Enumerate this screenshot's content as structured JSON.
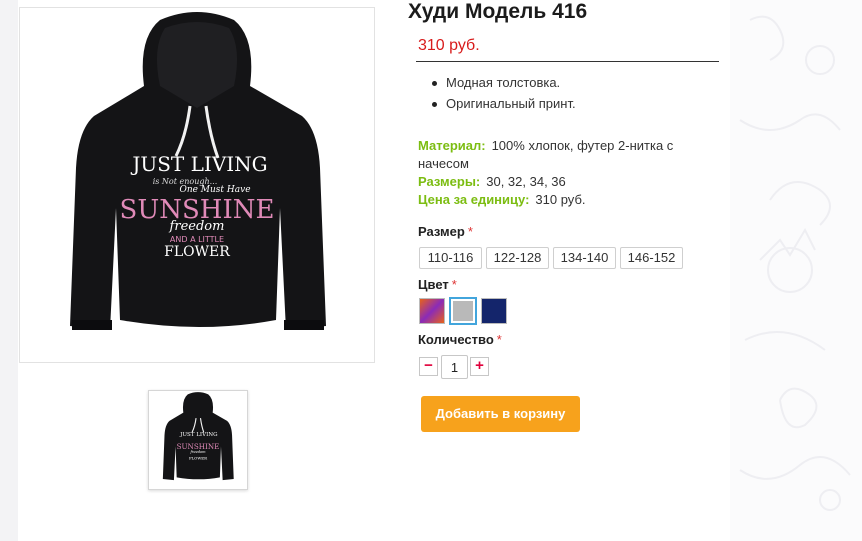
{
  "product": {
    "title": "Худи Модель 416",
    "price": "310 руб.",
    "features": [
      "Модная толстовка.",
      "Оригинальный принт."
    ],
    "specs": {
      "material_label": "Материал:",
      "material_value": "100% хлопок, футер 2-нитка с начесом",
      "sizes_label": "Размеры:",
      "sizes_value": "30, 32, 34, 36",
      "unit_price_label": "Цена за единицу:",
      "unit_price_value": "310 руб."
    },
    "print_text": {
      "line1": "JUST LIVING",
      "line2": "is Not enough...",
      "line3": "One Must Have",
      "line4": "SUNSHINE",
      "line5": "freedom",
      "line6": "AND A LITTLE",
      "line7": "FLOWER"
    }
  },
  "options": {
    "size_label": "Размер",
    "required_mark": "*",
    "sizes": [
      "110-116",
      "122-128",
      "134-140",
      "146-152"
    ],
    "color_label": "Цвет",
    "colors": [
      {
        "name": "multicolor",
        "value": "linear-gradient(135deg,#e8621a,#8a2bb8,#e8621a)"
      },
      {
        "name": "grey",
        "value": "#b9b9b9",
        "selected": true
      },
      {
        "name": "navy",
        "value": "#14256b"
      }
    ],
    "quantity_label": "Количество",
    "quantity_value": "1",
    "minus": "−",
    "plus": "+"
  },
  "cart": {
    "add_label": "Добавить в корзину"
  },
  "theme": {
    "accent": "#f7a21c",
    "price_color": "#d81b1b",
    "label_green": "#7cbd12"
  }
}
